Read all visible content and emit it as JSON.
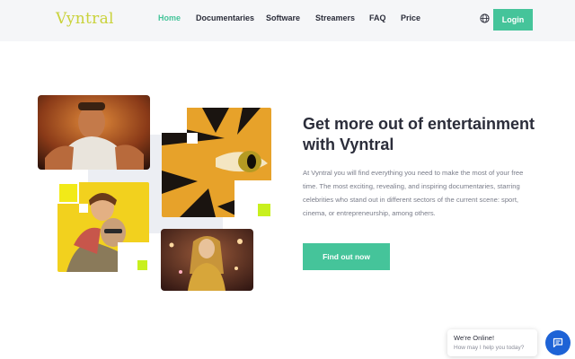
{
  "brand": {
    "logo_text": "Vyntral",
    "accent": "#45c49a",
    "logo_color": "#c9d23a"
  },
  "nav": {
    "items": [
      {
        "label": "Home",
        "active": true
      },
      {
        "label": "Documentaries",
        "active": false
      },
      {
        "label": "Software",
        "active": false
      },
      {
        "label": "Streamers",
        "active": false
      },
      {
        "label": "FAQ",
        "active": false
      },
      {
        "label": "Price",
        "active": false
      }
    ],
    "language_icon": "globe-icon",
    "login_label": "Login"
  },
  "hero": {
    "title": "Get more out of entertainment with Vyntral",
    "body": "At Vyntral you will find everything you need to make the most of your free time. The most exciting, revealing, and inspiring documentaries, starring celebrities who stand out in different sectors of the current scene: sport, cinema, or entrepreneurship, among others.",
    "cta_label": "Find out now"
  },
  "chat": {
    "title": "We're Online!",
    "subtitle": "How may I help you today?",
    "icon": "chat-icon"
  }
}
